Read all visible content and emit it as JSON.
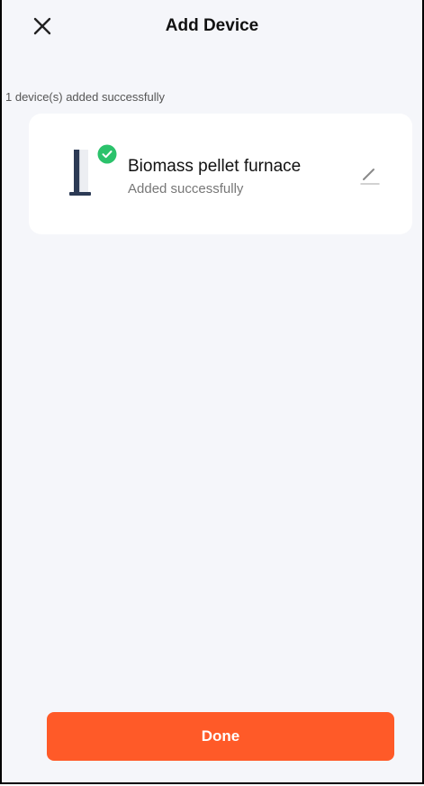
{
  "header": {
    "title": "Add Device",
    "close_icon": "close-icon"
  },
  "status": {
    "message": "1 device(s) added successfully"
  },
  "devices": [
    {
      "name": "Biomass pellet furnace",
      "status": "Added successfully",
      "image_icon": "furnace-device-image",
      "badge_icon": "check-circle-icon",
      "edit_icon": "pencil-icon"
    }
  ],
  "footer": {
    "done_label": "Done"
  },
  "colors": {
    "accent": "#ff5a28",
    "success": "#2bc26b",
    "background": "#f5f6fa"
  }
}
